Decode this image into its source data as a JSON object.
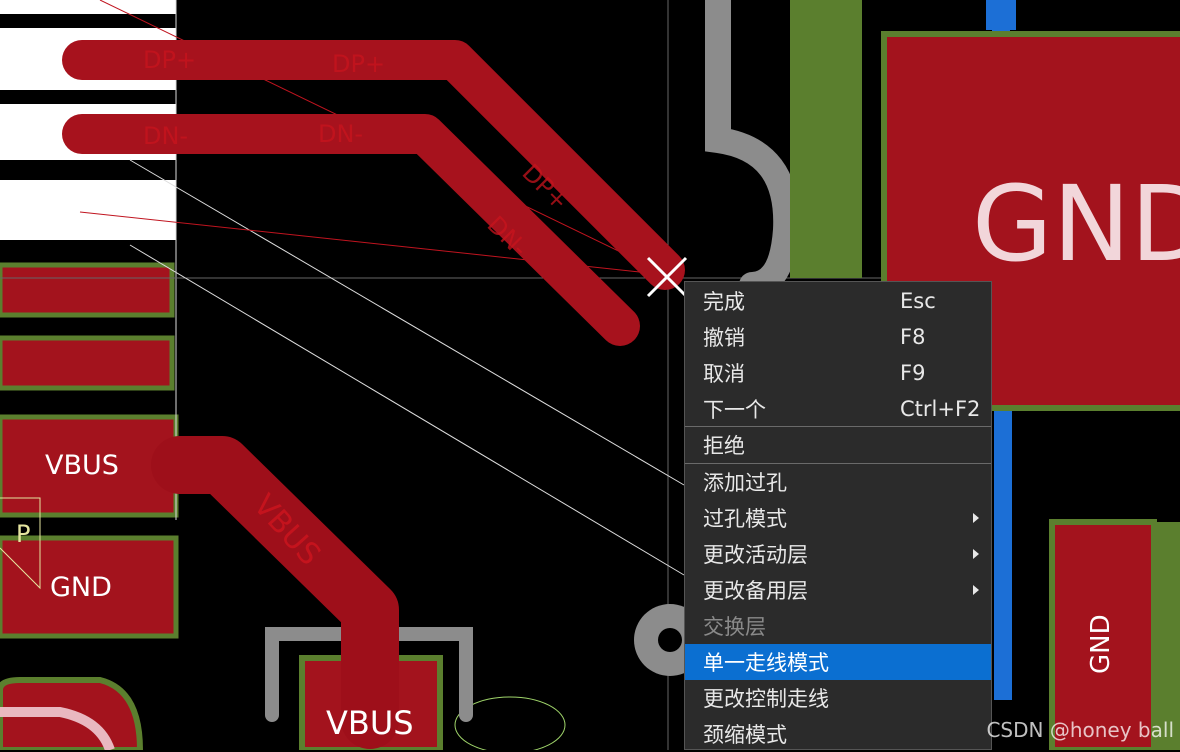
{
  "pcb": {
    "labels": {
      "gnd_big": "GND",
      "vbus_left": "VBUS",
      "gnd_left": "GND",
      "vbus_bottom": "VBUS",
      "gnd_vertical": "GND",
      "vbus_trace": "VBUS",
      "p_mark": "P"
    },
    "trace_labels": {
      "dp_pad": "DP+",
      "dn_pad": "DN-",
      "dp_trace": "DP+",
      "dn_trace": "DN-",
      "dp_diag": "DP+",
      "dn_diag": "DN-"
    },
    "colors": {
      "background": "#000000",
      "top_copper": "#a3131d",
      "routed_trace": "#9e0f1a",
      "pad_outline": "#5b7f2e",
      "bottom_layer": "#1c6fd6",
      "silkscreen": "#ffffff",
      "keepout_grey": "#8c8c8c"
    },
    "icons": [
      "crosshair-cursor-icon"
    ]
  },
  "context_menu": {
    "items": [
      {
        "label": "完成",
        "shortcut": "Esc",
        "submenu": false,
        "state": "normal"
      },
      {
        "label": "撤销",
        "shortcut": "F8",
        "submenu": false,
        "state": "normal"
      },
      {
        "label": "取消",
        "shortcut": "F9",
        "submenu": false,
        "state": "normal"
      },
      {
        "label": "下一个",
        "shortcut": "Ctrl+F2",
        "submenu": false,
        "state": "normal"
      },
      {
        "label": "拒绝",
        "shortcut": "",
        "submenu": false,
        "state": "normal"
      },
      {
        "label": "添加过孔",
        "shortcut": "",
        "submenu": false,
        "state": "normal"
      },
      {
        "label": "过孔模式",
        "shortcut": "",
        "submenu": true,
        "state": "normal"
      },
      {
        "label": "更改活动层",
        "shortcut": "",
        "submenu": true,
        "state": "normal"
      },
      {
        "label": "更改备用层",
        "shortcut": "",
        "submenu": true,
        "state": "normal"
      },
      {
        "label": "交换层",
        "shortcut": "",
        "submenu": false,
        "state": "disabled"
      },
      {
        "label": "单一走线模式",
        "shortcut": "",
        "submenu": false,
        "state": "highlighted"
      },
      {
        "label": "更改控制走线",
        "shortcut": "",
        "submenu": false,
        "state": "normal"
      },
      {
        "label": "颈缩模式",
        "shortcut": "",
        "submenu": false,
        "state": "normal"
      }
    ],
    "highlight_color": "#0b6fd1"
  },
  "watermark": "CSDN @honey ball"
}
